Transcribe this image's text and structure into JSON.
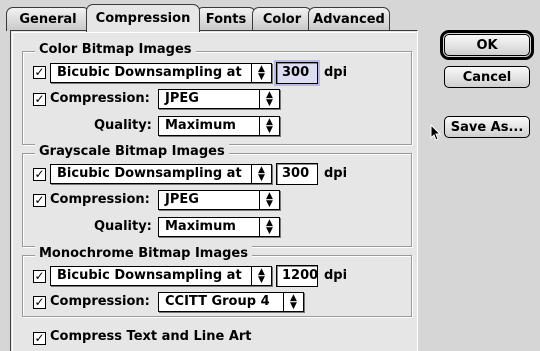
{
  "tabs": [
    "General",
    "Compression",
    "Fonts",
    "Color",
    "Advanced"
  ],
  "buttons": {
    "ok": "OK",
    "cancel": "Cancel",
    "save_as": "Save As..."
  },
  "color": {
    "title": "Color Bitmap Images",
    "downsample": "Bicubic Downsampling at",
    "dpi_value": "300",
    "dpi_unit": "dpi",
    "compression_label": "Compression:",
    "compression": "JPEG",
    "quality_label": "Quality:",
    "quality": "Maximum"
  },
  "grayscale": {
    "title": "Grayscale Bitmap Images",
    "downsample": "Bicubic Downsampling at",
    "dpi_value": "300",
    "dpi_unit": "dpi",
    "compression_label": "Compression:",
    "compression": "JPEG",
    "quality_label": "Quality:",
    "quality": "Maximum"
  },
  "mono": {
    "title": "Monochrome Bitmap Images",
    "downsample": "Bicubic Downsampling at",
    "dpi_value": "1200",
    "dpi_unit": "dpi",
    "compression_label": "Compression:",
    "compression": "CCITT Group 4"
  },
  "compress_text": "Compress Text and Line Art",
  "checks": {
    "mark": "☑"
  },
  "icons": {
    "popup_arrow": "updown-arrow-icon",
    "pointer": "arrow-pointer-icon"
  }
}
